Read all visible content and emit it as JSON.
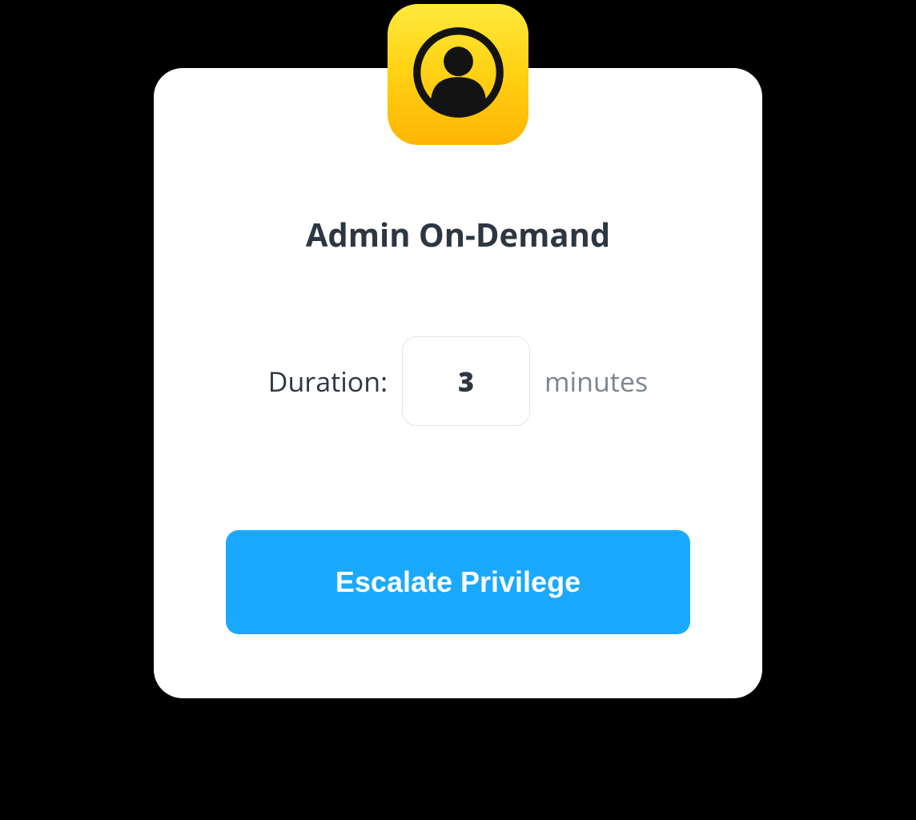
{
  "header": {
    "icon_name": "person-circle-icon"
  },
  "title": "Admin On-Demand",
  "duration": {
    "label": "Duration:",
    "value": "3",
    "unit": "minutes"
  },
  "actions": {
    "escalate_label": "Escalate Privilege"
  },
  "colors": {
    "brand": "#1aa9ff",
    "icon_bg_top": "#ffe93c",
    "icon_bg_bottom": "#ffb502",
    "text_dark": "#2c3742",
    "text_light": "#7a8691"
  }
}
